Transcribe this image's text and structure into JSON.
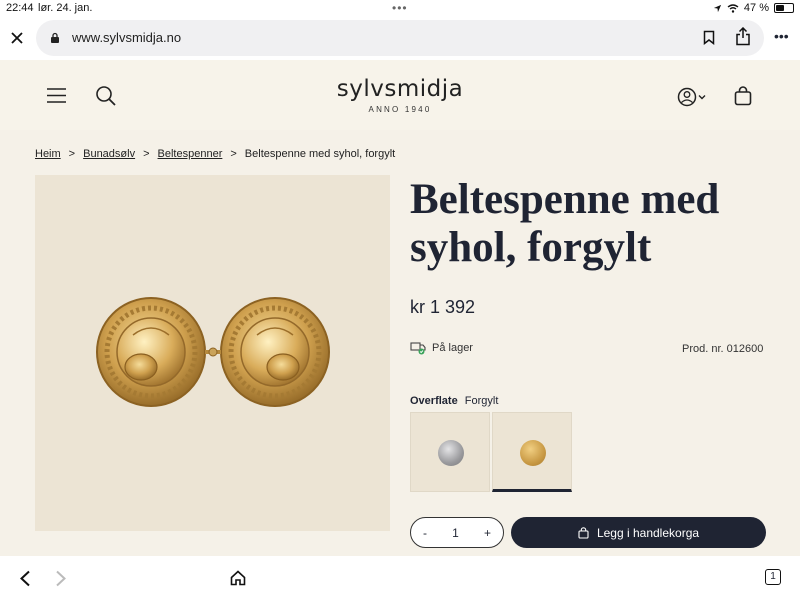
{
  "status_bar": {
    "time": "22:44",
    "date": "lør. 24. jan.",
    "battery": "47 %"
  },
  "browser": {
    "url": "www.sylvsmidja.no"
  },
  "site": {
    "logo_name": "sylvsmidja",
    "logo_sub": "ANNO 1940"
  },
  "breadcrumb": {
    "items": [
      "Heim",
      "Bunadsølv",
      "Beltespenner"
    ],
    "current": "Beltespenne med syhol, forgylt",
    "sep": ">"
  },
  "product": {
    "title": "Beltespenne med syhol, forgylt",
    "price": "kr 1 392",
    "stock": "På lager",
    "prod_nr": "Prod. nr. 012600",
    "finish_label": "Overflate",
    "finish_value": "Forgylt",
    "swatches": [
      {
        "name": "silver",
        "color": "#a9a9ab"
      },
      {
        "name": "gold",
        "color": "#c99a45"
      }
    ],
    "quantity": "1",
    "qty_minus": "-",
    "qty_plus": "+",
    "add_to_cart": "Legg i handlekorga"
  },
  "tabs": {
    "count": "1"
  },
  "colors": {
    "accent": "#1f2433",
    "background": "#f5f1e8",
    "image_bg": "#ece4d4",
    "gold": "#c99a45"
  }
}
